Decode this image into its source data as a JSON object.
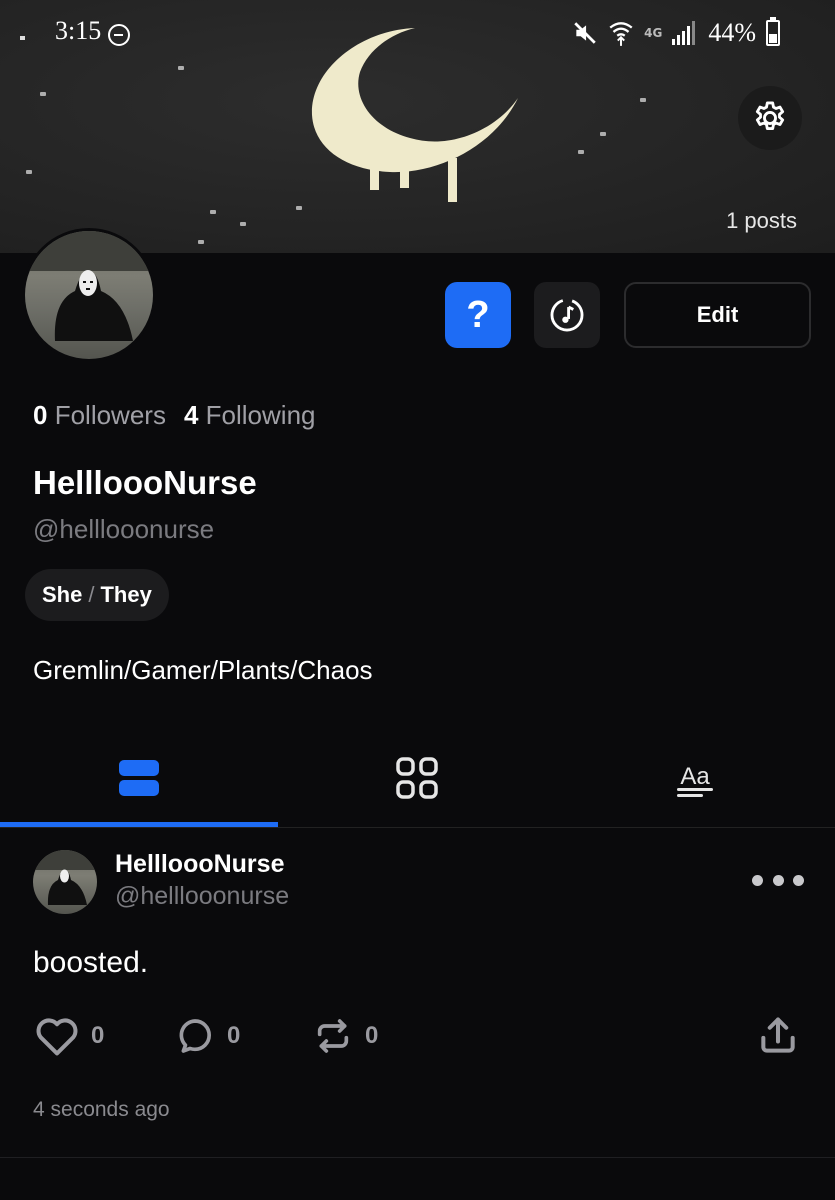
{
  "status_bar": {
    "time": "3:15",
    "network": "4G",
    "battery": "44%"
  },
  "profile": {
    "posts_count": "1 posts",
    "display_name": "HellloooNurse",
    "handle": "@helllooonurse",
    "followers_count": "0",
    "followers_label": "Followers",
    "following_count": "4",
    "following_label": "Following",
    "pronoun_first": "She",
    "pronoun_sep": "/",
    "pronoun_second": "They",
    "bio": "Gremlin/Gamer/Plants/Chaos"
  },
  "actions": {
    "help_label": "?",
    "edit_label": "Edit"
  },
  "tabs": [
    {
      "icon": "posts-list-icon",
      "active": true
    },
    {
      "icon": "grid-icon",
      "active": false
    },
    {
      "icon": "text-icon",
      "active": false,
      "glyph": "Aa"
    }
  ],
  "post": {
    "author_name": "HellloooNurse",
    "author_handle": "@helllooonurse",
    "text": "boosted.",
    "likes": "0",
    "replies": "0",
    "boosts": "0",
    "time": "4 seconds ago"
  },
  "colors": {
    "accent": "#1e6cf5",
    "background": "#0a0a0c",
    "muted_text": "#7b7b80"
  }
}
